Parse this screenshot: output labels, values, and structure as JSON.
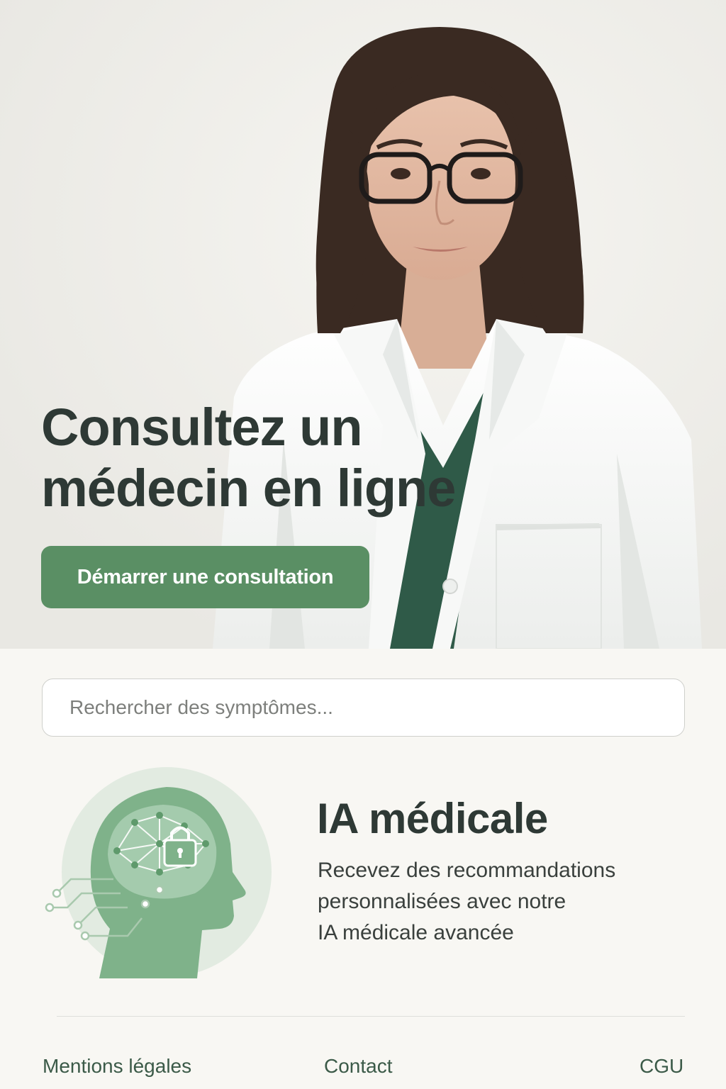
{
  "hero": {
    "title_line1": "Consultez un",
    "title_line2": "médecin en ligne",
    "cta_label": "Démarrer une consultation"
  },
  "search": {
    "placeholder": "Rechercher des symptômes..."
  },
  "feature": {
    "title": "IA médicale",
    "desc_line1": "Recevez des recommandations",
    "desc_line2": "personnalisées avec notre",
    "desc_line3": "IA médicale avancée",
    "icon": "ai-head-lock-icon"
  },
  "footer": {
    "links": [
      "Mentions légales",
      "Contact",
      "CGU"
    ]
  },
  "colors": {
    "accent": "#5a8f64",
    "title": "#2e3935",
    "footer_link": "#3b5a48",
    "background": "#f8f7f3"
  }
}
